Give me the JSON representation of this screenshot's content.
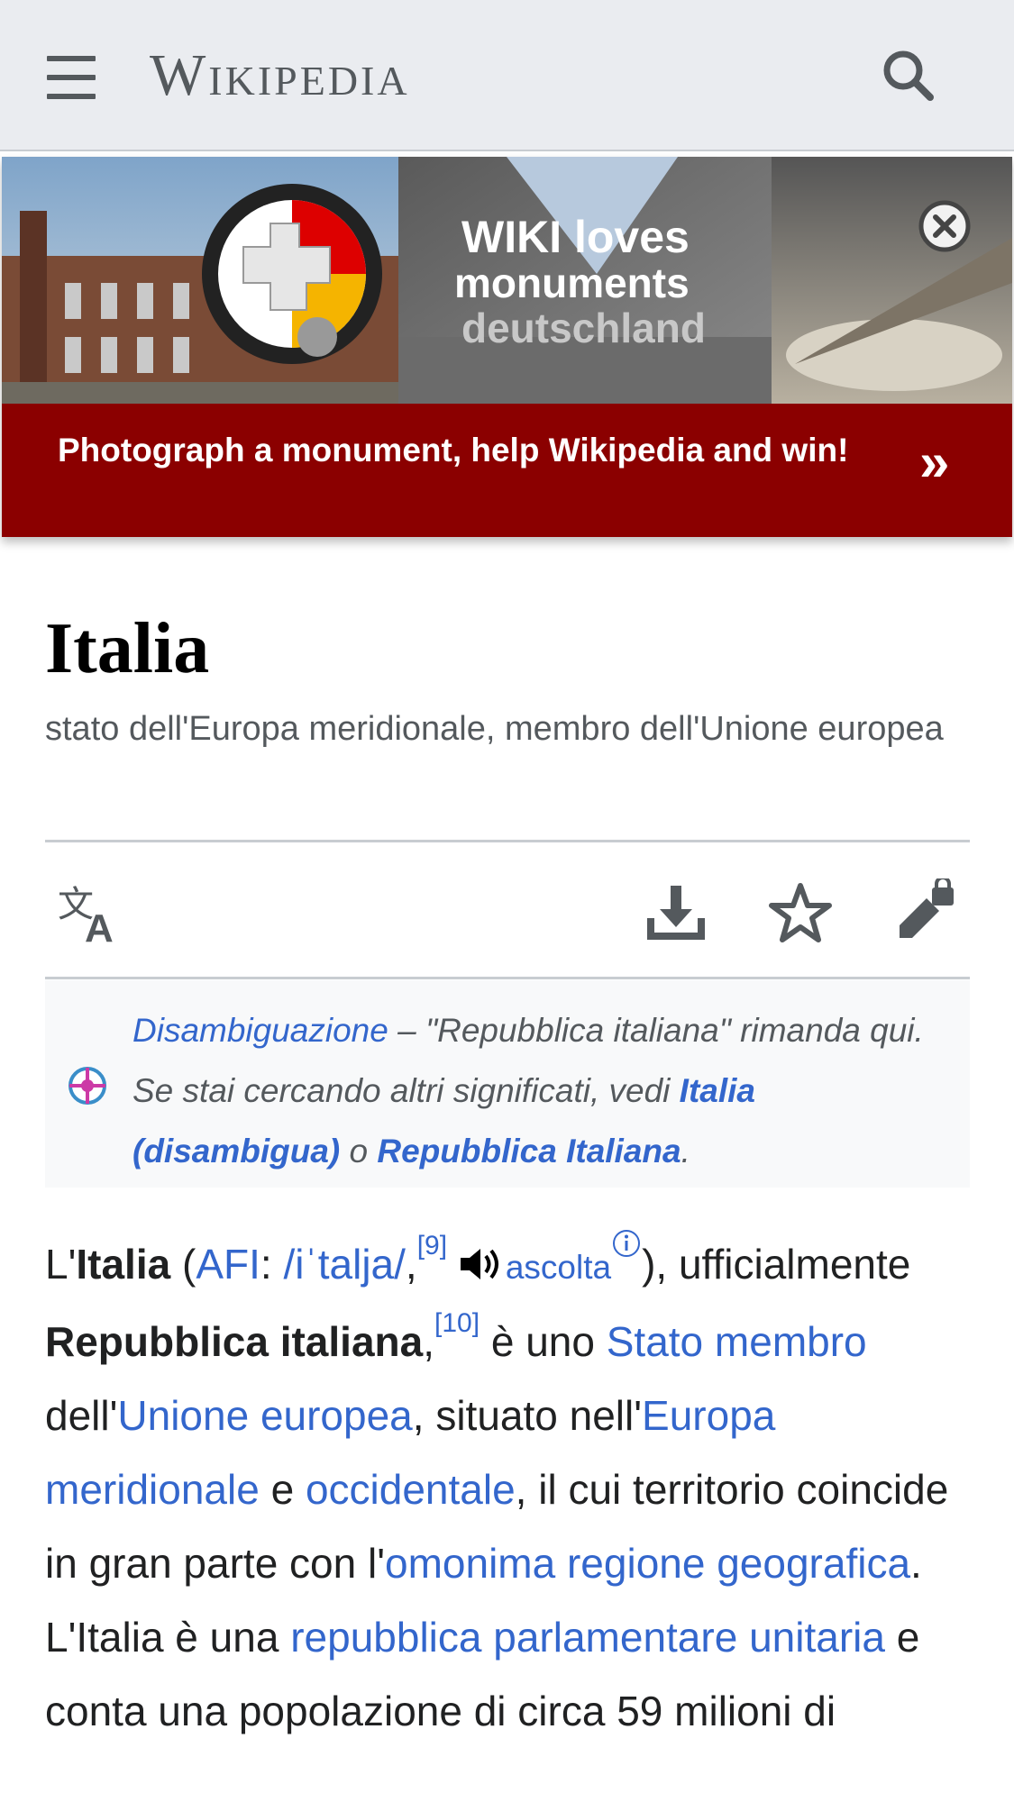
{
  "header": {
    "wordmark": "Wikipedia",
    "menu_icon": "hamburger-menu-icon",
    "search_icon": "search-icon"
  },
  "banner": {
    "image_lines": [
      "WIKI loves",
      "monuments",
      "deutschland"
    ],
    "text": "Photograph a monument, help Wikipedia and win!",
    "arrow": "»",
    "close_icon": "close-circle-icon",
    "color": "#8b0000"
  },
  "page": {
    "title": "Italia",
    "description": "stato dell'Europa meridionale, membro dell'Unione europea"
  },
  "page_actions": [
    {
      "name": "language",
      "icon": "translate-icon"
    },
    {
      "name": "download",
      "icon": "download-icon"
    },
    {
      "name": "watch",
      "icon": "star-icon"
    },
    {
      "name": "edit",
      "icon": "edit-protected-icon"
    }
  ],
  "hatnote": {
    "icon": "disambiguation-icon",
    "link_disambig": "Disambiguazione",
    "text_1": " – \"Repubblica italiana\" rimanda qui. Se stai cercando altri significati, vedi ",
    "link_1": "Italia (disambigua)",
    "text_2": " o ",
    "link_2": "Repubblica Italiana",
    "text_3": "."
  },
  "body": {
    "t1": "L'",
    "b1": "Italia",
    "t2": " (",
    "l_afi": "AFI",
    "t3": ": ",
    "l_ipa": "/iˈtalja/",
    "t4": ",",
    "ref9": "[9]",
    "audio_label": "ascolta",
    "t5": "),",
    "t6": " ufficialmente ",
    "b2": "Repubblica italiana",
    "t7": ",",
    "ref10": "[10]",
    "t8": " è uno ",
    "l_stato": "Stato membro",
    "t9": " dell'",
    "l_ue": "Unione europea",
    "t10": ", situato nell'",
    "l_eur": "Europa meridionale",
    "t11": " e ",
    "l_occ": "occidentale",
    "t12": ", il cui territorio coincide in gran parte con l'",
    "l_reg": "omonima regione geografica",
    "t13": ". L'Italia è una ",
    "l_rep": "repubblica parlamentare unitaria",
    "t14": " e conta una popolazione di circa 59 milioni di"
  }
}
